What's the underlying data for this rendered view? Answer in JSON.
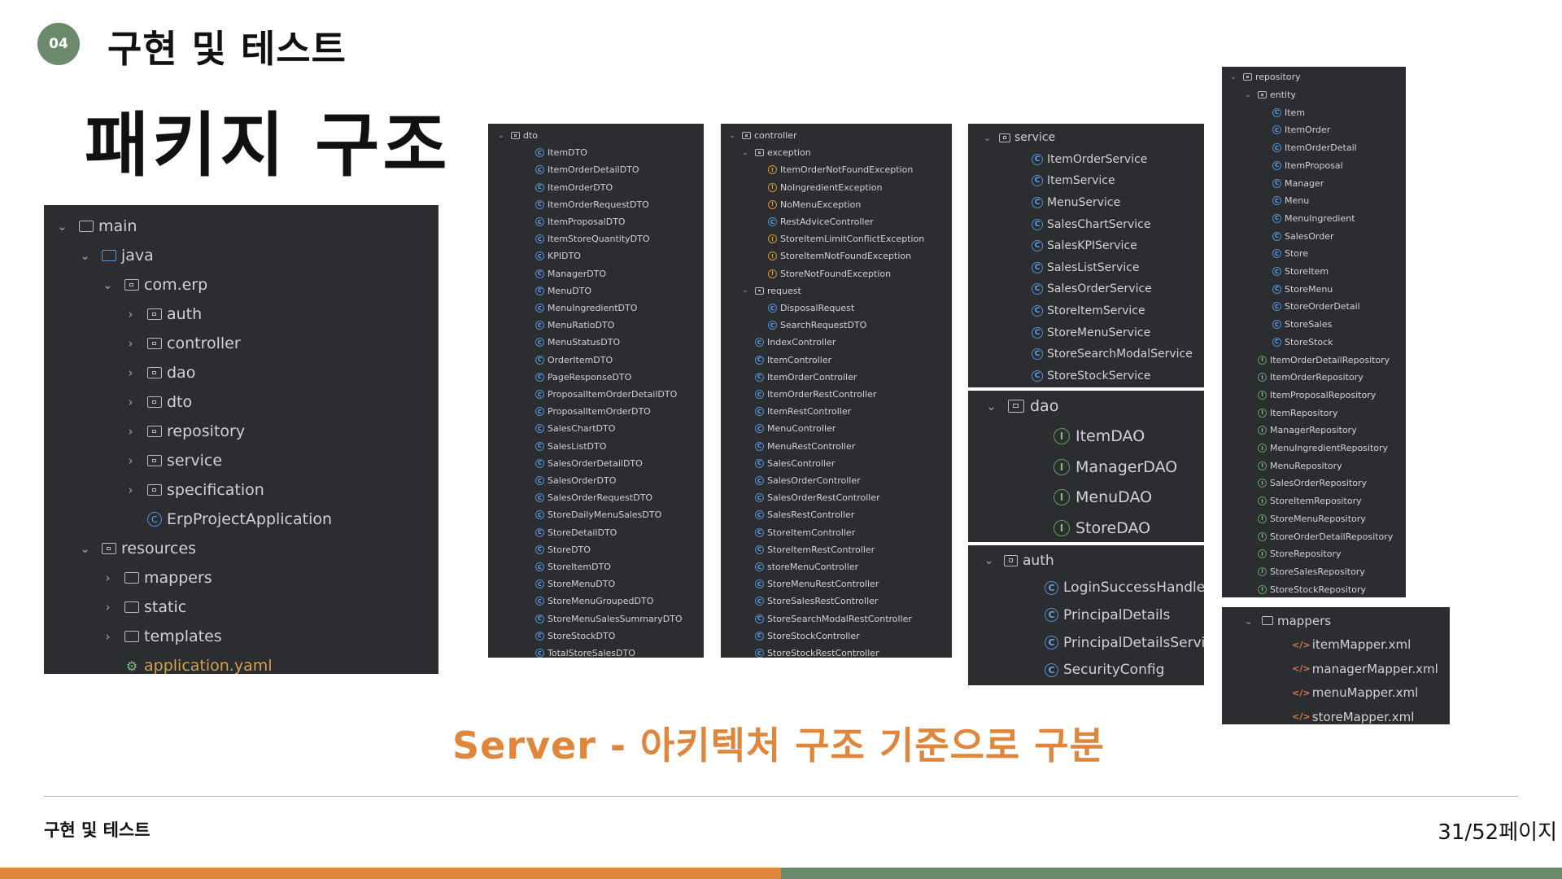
{
  "header": {
    "badge": "04",
    "section_title": "구현 및 테스트",
    "main_title": "패키지 구조"
  },
  "caption": "Server - 아키텍처 구조 기준으로 구분",
  "footer": {
    "left": "구현 및 테스트",
    "page": "31/52페이지"
  },
  "colors": {
    "accent_orange": "#e0863b",
    "accent_green": "#6b8a6b",
    "panel_bg": "#2b2d30"
  },
  "panels": [
    {
      "id": "main-tree",
      "items": [
        {
          "label": "main",
          "icon": "folder-icon",
          "indent": 0,
          "chevron": "v"
        },
        {
          "label": "java",
          "icon": "source-folder-icon",
          "indent": 1,
          "chevron": "v"
        },
        {
          "label": "com.erp",
          "icon": "package-icon",
          "indent": 2,
          "chevron": "v"
        },
        {
          "label": "auth",
          "icon": "package-icon",
          "indent": 3,
          "chevron": ">"
        },
        {
          "label": "controller",
          "icon": "package-icon",
          "indent": 3,
          "chevron": ">"
        },
        {
          "label": "dao",
          "icon": "package-icon",
          "indent": 3,
          "chevron": ">"
        },
        {
          "label": "dto",
          "icon": "package-icon",
          "indent": 3,
          "chevron": ">"
        },
        {
          "label": "repository",
          "icon": "package-icon",
          "indent": 3,
          "chevron": ">"
        },
        {
          "label": "service",
          "icon": "package-icon",
          "indent": 3,
          "chevron": ">"
        },
        {
          "label": "specification",
          "icon": "package-icon",
          "indent": 3,
          "chevron": ">"
        },
        {
          "label": "ErpProjectApplication",
          "icon": "spring-app-icon",
          "indent": 3,
          "chevron": ""
        },
        {
          "label": "resources",
          "icon": "resources-folder-icon",
          "indent": 1,
          "chevron": "v"
        },
        {
          "label": "mappers",
          "icon": "folder-icon",
          "indent": 2,
          "chevron": ">"
        },
        {
          "label": "static",
          "icon": "folder-icon",
          "indent": 2,
          "chevron": ">"
        },
        {
          "label": "templates",
          "icon": "folder-icon",
          "indent": 2,
          "chevron": ">"
        },
        {
          "label": "application.yaml",
          "icon": "yaml-icon",
          "indent": 2,
          "chevron": ""
        }
      ]
    },
    {
      "id": "dto-tree",
      "items": [
        {
          "label": "dto",
          "icon": "package-icon",
          "indent": 0,
          "chevron": "v"
        },
        {
          "label": "ItemDTO",
          "icon": "class-icon",
          "indent": 1,
          "chevron": ""
        },
        {
          "label": "ItemOrderDetailDTO",
          "icon": "class-icon",
          "indent": 1,
          "chevron": ""
        },
        {
          "label": "ItemOrderDTO",
          "icon": "class-icon",
          "indent": 1,
          "chevron": ""
        },
        {
          "label": "ItemOrderRequestDTO",
          "icon": "class-icon",
          "indent": 1,
          "chevron": ""
        },
        {
          "label": "ItemProposalDTO",
          "icon": "class-icon",
          "indent": 1,
          "chevron": ""
        },
        {
          "label": "ItemStoreQuantityDTO",
          "icon": "class-icon",
          "indent": 1,
          "chevron": ""
        },
        {
          "label": "KPIDTO",
          "icon": "class-icon",
          "indent": 1,
          "chevron": ""
        },
        {
          "label": "ManagerDTO",
          "icon": "class-icon",
          "indent": 1,
          "chevron": ""
        },
        {
          "label": "MenuDTO",
          "icon": "class-icon",
          "indent": 1,
          "chevron": ""
        },
        {
          "label": "MenuIngredientDTO",
          "icon": "class-icon",
          "indent": 1,
          "chevron": ""
        },
        {
          "label": "MenuRatioDTO",
          "icon": "class-icon",
          "indent": 1,
          "chevron": ""
        },
        {
          "label": "MenuStatusDTO",
          "icon": "class-icon",
          "indent": 1,
          "chevron": ""
        },
        {
          "label": "OrderItemDTO",
          "icon": "class-icon",
          "indent": 1,
          "chevron": ""
        },
        {
          "label": "PageResponseDTO",
          "icon": "class-icon",
          "indent": 1,
          "chevron": ""
        },
        {
          "label": "ProposalItemOrderDetailDTO",
          "icon": "class-icon",
          "indent": 1,
          "chevron": ""
        },
        {
          "label": "ProposalItemOrderDTO",
          "icon": "class-icon",
          "indent": 1,
          "chevron": ""
        },
        {
          "label": "SalesChartDTO",
          "icon": "class-icon",
          "indent": 1,
          "chevron": ""
        },
        {
          "label": "SalesListDTO",
          "icon": "class-icon",
          "indent": 1,
          "chevron": ""
        },
        {
          "label": "SalesOrderDetailDTO",
          "icon": "class-icon",
          "indent": 1,
          "chevron": ""
        },
        {
          "label": "SalesOrderDTO",
          "icon": "class-icon",
          "indent": 1,
          "chevron": ""
        },
        {
          "label": "SalesOrderRequestDTO",
          "icon": "class-icon",
          "indent": 1,
          "chevron": ""
        },
        {
          "label": "StoreDailyMenuSalesDTO",
          "icon": "class-icon",
          "indent": 1,
          "chevron": ""
        },
        {
          "label": "StoreDetailDTO",
          "icon": "class-icon",
          "indent": 1,
          "chevron": ""
        },
        {
          "label": "StoreDTO",
          "icon": "class-icon",
          "indent": 1,
          "chevron": ""
        },
        {
          "label": "StoreItemDTO",
          "icon": "class-icon",
          "indent": 1,
          "chevron": ""
        },
        {
          "label": "StoreMenuDTO",
          "icon": "class-icon",
          "indent": 1,
          "chevron": ""
        },
        {
          "label": "StoreMenuGroupedDTO",
          "icon": "class-icon",
          "indent": 1,
          "chevron": ""
        },
        {
          "label": "StoreMenuSalesSummaryDTO",
          "icon": "class-icon",
          "indent": 1,
          "chevron": ""
        },
        {
          "label": "StoreStockDTO",
          "icon": "class-icon",
          "indent": 1,
          "chevron": ""
        },
        {
          "label": "TotalStoreSalesDTO",
          "icon": "class-icon",
          "indent": 1,
          "chevron": ""
        }
      ]
    },
    {
      "id": "controller-tree",
      "items": [
        {
          "label": "controller",
          "icon": "package-icon",
          "indent": 0,
          "chevron": "v"
        },
        {
          "label": "exception",
          "icon": "package-icon",
          "indent": 1,
          "chevron": "v"
        },
        {
          "label": "ItemOrderNotFoundException",
          "icon": "exception-icon",
          "indent": 2,
          "chevron": ""
        },
        {
          "label": "NoIngredientException",
          "icon": "exception-icon",
          "indent": 2,
          "chevron": ""
        },
        {
          "label": "NoMenuException",
          "icon": "exception-icon",
          "indent": 2,
          "chevron": ""
        },
        {
          "label": "RestAdviceController",
          "icon": "class-icon",
          "indent": 2,
          "chevron": ""
        },
        {
          "label": "StoreItemLimitConflictException",
          "icon": "exception-icon",
          "indent": 2,
          "chevron": ""
        },
        {
          "label": "StoreItemNotFoundException",
          "icon": "exception-icon",
          "indent": 2,
          "chevron": ""
        },
        {
          "label": "StoreNotFoundException",
          "icon": "exception-icon",
          "indent": 2,
          "chevron": ""
        },
        {
          "label": "request",
          "icon": "package-icon",
          "indent": 1,
          "chevron": "v"
        },
        {
          "label": "DisposalRequest",
          "icon": "class-icon",
          "indent": 2,
          "chevron": ""
        },
        {
          "label": "SearchRequestDTO",
          "icon": "class-icon",
          "indent": 2,
          "chevron": ""
        },
        {
          "label": "IndexController",
          "icon": "class-icon",
          "indent": 1,
          "chevron": ""
        },
        {
          "label": "ItemController",
          "icon": "class-icon",
          "indent": 1,
          "chevron": ""
        },
        {
          "label": "ItemOrderController",
          "icon": "class-icon",
          "indent": 1,
          "chevron": ""
        },
        {
          "label": "ItemOrderRestController",
          "icon": "class-icon",
          "indent": 1,
          "chevron": ""
        },
        {
          "label": "ItemRestController",
          "icon": "class-icon",
          "indent": 1,
          "chevron": ""
        },
        {
          "label": "MenuController",
          "icon": "class-icon",
          "indent": 1,
          "chevron": ""
        },
        {
          "label": "MenuRestController",
          "icon": "class-icon",
          "indent": 1,
          "chevron": ""
        },
        {
          "label": "SalesController",
          "icon": "class-icon",
          "indent": 1,
          "chevron": ""
        },
        {
          "label": "SalesOrderController",
          "icon": "class-icon",
          "indent": 1,
          "chevron": ""
        },
        {
          "label": "SalesOrderRestController",
          "icon": "class-icon",
          "indent": 1,
          "chevron": ""
        },
        {
          "label": "SalesRestController",
          "icon": "class-icon",
          "indent": 1,
          "chevron": ""
        },
        {
          "label": "StoreItemController",
          "icon": "class-icon",
          "indent": 1,
          "chevron": ""
        },
        {
          "label": "StoreItemRestController",
          "icon": "class-icon",
          "indent": 1,
          "chevron": ""
        },
        {
          "label": "storeMenuController",
          "icon": "class-icon",
          "indent": 1,
          "chevron": ""
        },
        {
          "label": "StoreMenuRestController",
          "icon": "class-icon",
          "indent": 1,
          "chevron": ""
        },
        {
          "label": "StoreSalesRestController",
          "icon": "class-icon",
          "indent": 1,
          "chevron": ""
        },
        {
          "label": "StoreSearchModalRestController",
          "icon": "class-icon",
          "indent": 1,
          "chevron": ""
        },
        {
          "label": "StoreStockController",
          "icon": "class-icon",
          "indent": 1,
          "chevron": ""
        },
        {
          "label": "StoreStockRestController",
          "icon": "class-icon",
          "indent": 1,
          "chevron": ""
        }
      ]
    },
    {
      "id": "service-tree",
      "items": [
        {
          "label": "service",
          "icon": "package-icon",
          "indent": 0,
          "chevron": "v"
        },
        {
          "label": "ItemOrderService",
          "icon": "class-icon",
          "indent": 1,
          "chevron": ""
        },
        {
          "label": "ItemService",
          "icon": "class-icon",
          "indent": 1,
          "chevron": ""
        },
        {
          "label": "MenuService",
          "icon": "class-icon",
          "indent": 1,
          "chevron": ""
        },
        {
          "label": "SalesChartService",
          "icon": "class-icon",
          "indent": 1,
          "chevron": ""
        },
        {
          "label": "SalesKPIService",
          "icon": "class-icon",
          "indent": 1,
          "chevron": ""
        },
        {
          "label": "SalesListService",
          "icon": "class-icon",
          "indent": 1,
          "chevron": ""
        },
        {
          "label": "SalesOrderService",
          "icon": "class-icon",
          "indent": 1,
          "chevron": ""
        },
        {
          "label": "StoreItemService",
          "icon": "class-icon",
          "indent": 1,
          "chevron": ""
        },
        {
          "label": "StoreMenuService",
          "icon": "class-icon",
          "indent": 1,
          "chevron": ""
        },
        {
          "label": "StoreSearchModalService",
          "icon": "class-icon",
          "indent": 1,
          "chevron": ""
        },
        {
          "label": "StoreStockService",
          "icon": "class-icon",
          "indent": 1,
          "chevron": ""
        }
      ]
    },
    {
      "id": "dao-tree",
      "items": [
        {
          "label": "dao",
          "icon": "package-icon",
          "indent": 0,
          "chevron": "v"
        },
        {
          "label": "ItemDAO",
          "icon": "interface-icon",
          "indent": 1,
          "chevron": ""
        },
        {
          "label": "ManagerDAO",
          "icon": "interface-icon",
          "indent": 1,
          "chevron": ""
        },
        {
          "label": "MenuDAO",
          "icon": "interface-icon",
          "indent": 1,
          "chevron": ""
        },
        {
          "label": "StoreDAO",
          "icon": "interface-icon",
          "indent": 1,
          "chevron": ""
        }
      ]
    },
    {
      "id": "auth-tree",
      "items": [
        {
          "label": "auth",
          "icon": "package-icon",
          "indent": 0,
          "chevron": "v"
        },
        {
          "label": "LoginSuccessHandler",
          "icon": "class-icon",
          "indent": 1,
          "chevron": ""
        },
        {
          "label": "PrincipalDetails",
          "icon": "class-icon",
          "indent": 1,
          "chevron": ""
        },
        {
          "label": "PrincipalDetailsService",
          "icon": "class-icon",
          "indent": 1,
          "chevron": ""
        },
        {
          "label": "SecurityConfig",
          "icon": "class-icon",
          "indent": 1,
          "chevron": ""
        }
      ]
    },
    {
      "id": "repository-tree",
      "items": [
        {
          "label": "repository",
          "icon": "package-icon",
          "indent": 0,
          "chevron": "v"
        },
        {
          "label": "entity",
          "icon": "package-icon",
          "indent": 1,
          "chevron": "v"
        },
        {
          "label": "Item",
          "icon": "class-icon",
          "indent": 2,
          "chevron": ""
        },
        {
          "label": "ItemOrder",
          "icon": "class-icon",
          "indent": 2,
          "chevron": ""
        },
        {
          "label": "ItemOrderDetail",
          "icon": "class-icon",
          "indent": 2,
          "chevron": ""
        },
        {
          "label": "ItemProposal",
          "icon": "class-icon",
          "indent": 2,
          "chevron": ""
        },
        {
          "label": "Manager",
          "icon": "class-icon",
          "indent": 2,
          "chevron": ""
        },
        {
          "label": "Menu",
          "icon": "class-icon",
          "indent": 2,
          "chevron": ""
        },
        {
          "label": "MenuIngredient",
          "icon": "class-icon",
          "indent": 2,
          "chevron": ""
        },
        {
          "label": "SalesOrder",
          "icon": "class-icon",
          "indent": 2,
          "chevron": ""
        },
        {
          "label": "Store",
          "icon": "class-icon",
          "indent": 2,
          "chevron": ""
        },
        {
          "label": "StoreItem",
          "icon": "class-icon",
          "indent": 2,
          "chevron": ""
        },
        {
          "label": "StoreMenu",
          "icon": "class-icon",
          "indent": 2,
          "chevron": ""
        },
        {
          "label": "StoreOrderDetail",
          "icon": "class-icon",
          "indent": 2,
          "chevron": ""
        },
        {
          "label": "StoreSales",
          "icon": "class-icon",
          "indent": 2,
          "chevron": ""
        },
        {
          "label": "StoreStock",
          "icon": "class-icon",
          "indent": 2,
          "chevron": ""
        },
        {
          "label": "ItemOrderDetailRepository",
          "icon": "interface-icon",
          "indent": 1,
          "chevron": ""
        },
        {
          "label": "ItemOrderRepository",
          "icon": "interface-icon",
          "indent": 1,
          "chevron": ""
        },
        {
          "label": "ItemProposalRepository",
          "icon": "interface-icon",
          "indent": 1,
          "chevron": ""
        },
        {
          "label": "ItemRepository",
          "icon": "interface-icon",
          "indent": 1,
          "chevron": ""
        },
        {
          "label": "ManagerRepository",
          "icon": "interface-icon",
          "indent": 1,
          "chevron": ""
        },
        {
          "label": "MenuIngredientRepository",
          "icon": "interface-icon",
          "indent": 1,
          "chevron": ""
        },
        {
          "label": "MenuRepository",
          "icon": "interface-icon",
          "indent": 1,
          "chevron": ""
        },
        {
          "label": "SalesOrderRepository",
          "icon": "interface-icon",
          "indent": 1,
          "chevron": ""
        },
        {
          "label": "StoreItemRepository",
          "icon": "interface-icon",
          "indent": 1,
          "chevron": ""
        },
        {
          "label": "StoreMenuRepository",
          "icon": "interface-icon",
          "indent": 1,
          "chevron": ""
        },
        {
          "label": "StoreOrderDetailRepository",
          "icon": "interface-icon",
          "indent": 1,
          "chevron": ""
        },
        {
          "label": "StoreRepository",
          "icon": "interface-icon",
          "indent": 1,
          "chevron": ""
        },
        {
          "label": "StoreSalesRepository",
          "icon": "interface-icon",
          "indent": 1,
          "chevron": ""
        },
        {
          "label": "StoreStockRepository",
          "icon": "interface-icon",
          "indent": 1,
          "chevron": ""
        }
      ]
    },
    {
      "id": "mappers-tree",
      "items": [
        {
          "label": "mappers",
          "icon": "folder-icon",
          "indent": 0,
          "chevron": "v"
        },
        {
          "label": "itemMapper.xml",
          "icon": "xml-icon",
          "indent": 1,
          "chevron": ""
        },
        {
          "label": "managerMapper.xml",
          "icon": "xml-icon",
          "indent": 1,
          "chevron": ""
        },
        {
          "label": "menuMapper.xml",
          "icon": "xml-icon",
          "indent": 1,
          "chevron": ""
        },
        {
          "label": "storeMapper.xml",
          "icon": "xml-icon",
          "indent": 1,
          "chevron": ""
        }
      ]
    }
  ]
}
